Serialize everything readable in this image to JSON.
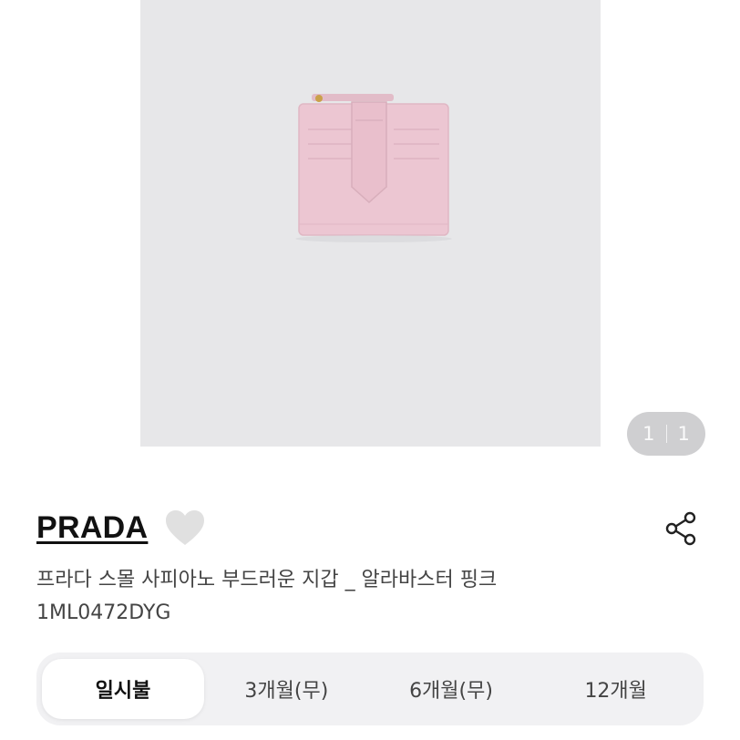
{
  "product": {
    "image_counter": {
      "current": "1",
      "total": "1"
    },
    "brand": "PRADA",
    "name": "프라다 스몰 사피아노 부드러운 지갑 _ 알라바스터 핑크",
    "code": "1ML0472DYG"
  },
  "payment_tabs": [
    {
      "label": "일시불",
      "active": true
    },
    {
      "label": "3개월(무)",
      "active": false
    },
    {
      "label": "6개월(무)",
      "active": false
    },
    {
      "label": "12개월",
      "active": false
    }
  ],
  "colors": {
    "image_background": "#e7e7e9",
    "wallet_pink": "#ecc6d2",
    "heart_gray": "#e0e0e0",
    "tabs_background": "#f1f1f3"
  },
  "icons": {
    "favorite": "heart-icon",
    "share": "share-icon"
  }
}
